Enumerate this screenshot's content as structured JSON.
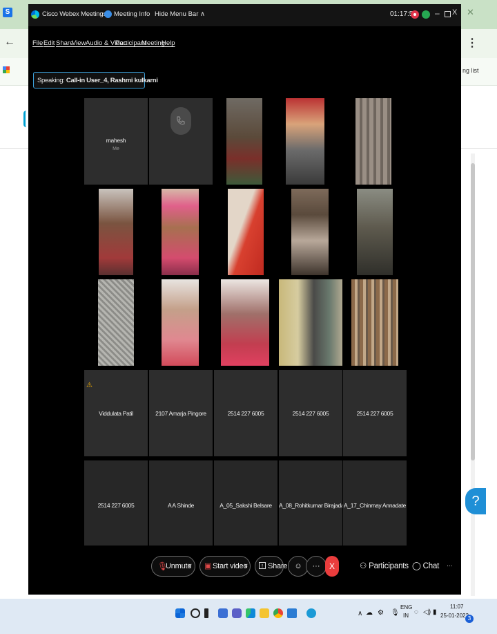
{
  "webex": {
    "title": "Cisco Webex Meetings",
    "meeting_info": "Meeting Info",
    "hide_menu_bar": "Hide Menu Bar ∧",
    "timer": "01:17:55",
    "menu": [
      "File",
      "Edit",
      "Share",
      "View",
      "Audio & Video",
      "Participant",
      "Meeting",
      "Help"
    ],
    "speaking_label": "Speaking:",
    "speaking_names": "Call-in User_4, Rashmi kulkarni"
  },
  "tiles": {
    "self_name": "mahesh",
    "self_sub": "Me",
    "row4": [
      "Viddulata Patil",
      "2107 Amarja Pingore",
      "2514 227 6005",
      "2514 227 6005",
      "2514 227 6005"
    ],
    "row5": [
      "2514 227 6005",
      "A A Shinde",
      "A_05_Sakshi Belsare",
      "A_08_Rohitkumar Birajadar",
      "A_17_Chinmay Annadate"
    ]
  },
  "controls": {
    "unmute": "Unmute",
    "start_video": "Start video",
    "share": "Share",
    "more": "···",
    "leave": "X",
    "participants": "Participants",
    "chat": "Chat",
    "overflow": "···"
  },
  "browser": {
    "reading_list": "ng list",
    "tab_letter": "S",
    "help": "?"
  },
  "taskbar": {
    "lang_top": "ENG",
    "lang_bottom": "IN",
    "time": "11:07",
    "date": "25-01-2022",
    "notifications": "3"
  },
  "colors": {
    "accent": "#3b9fd9",
    "leave": "#ea3d3d",
    "record": "#e0344a"
  }
}
